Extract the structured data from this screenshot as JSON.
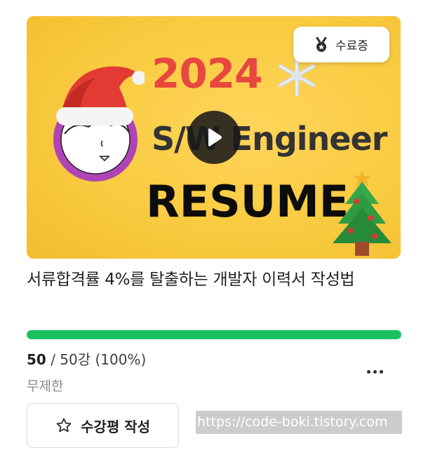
{
  "thumbnail": {
    "year_text": "2024",
    "line2_text": "S/W Engineer",
    "line3_text": "RESUME",
    "background_color": "#f8c93e",
    "certificate_badge": {
      "icon": "medal-icon",
      "label": "수료증"
    },
    "play_icon": "play-icon"
  },
  "course": {
    "title": "서류합격률 4%를 탈출하는 개발자 이력서 작성법",
    "progress": {
      "completed": "50",
      "separator_total": " / 50강 (100%)",
      "fraction": 1.0,
      "color": "#1bc15e"
    },
    "period": "무제한",
    "more_icon": "more-horizontal-icon",
    "review_button": {
      "icon": "star-outline-icon",
      "label": "수강평 작성"
    }
  },
  "watermark": "https://code-boki.tistory.com"
}
